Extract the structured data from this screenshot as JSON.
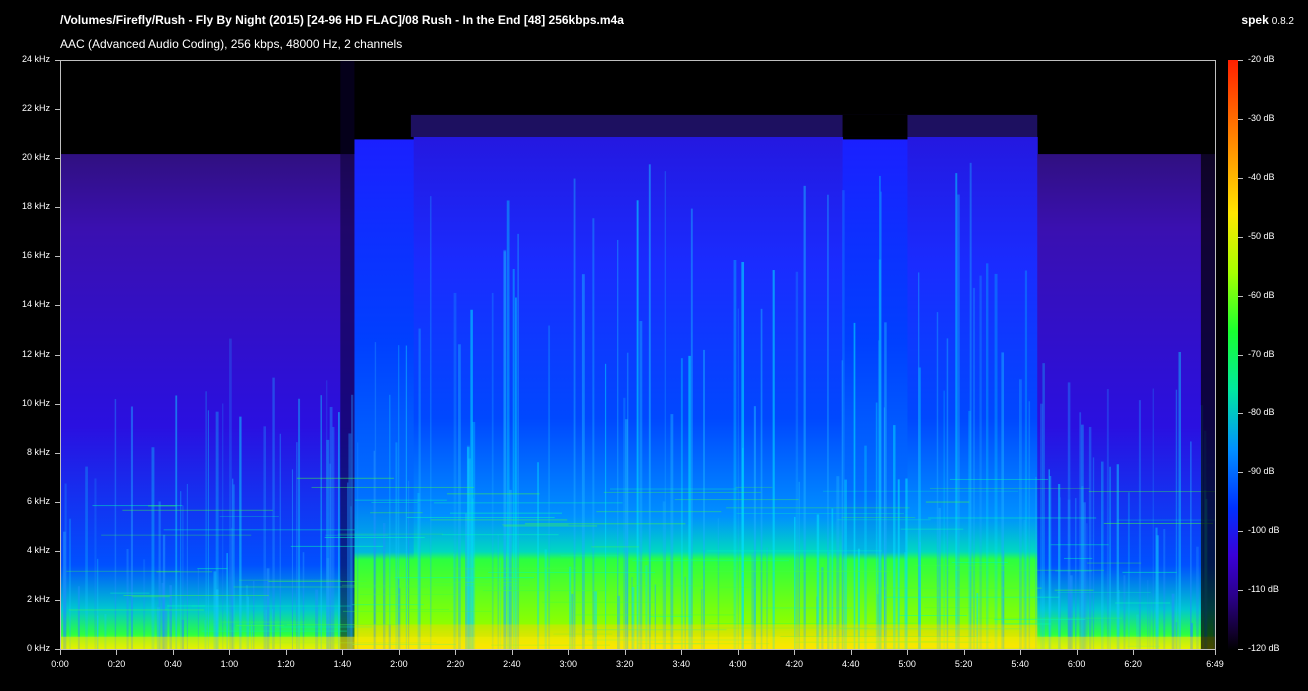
{
  "header": {
    "file_path": "/Volumes/Firefly/Rush - Fly By Night (2015) [24-96 HD FLAC]/08 Rush - In the End [48] 256kbps.m4a",
    "stream_info": "AAC (Advanced Audio Coding), 256 kbps, 48000 Hz, 2 channels",
    "app_name": "spek",
    "app_version": "0.8.2"
  },
  "chart_data": {
    "type": "heatmap",
    "title": "",
    "xlabel": "",
    "ylabel": "",
    "x_ticks": [
      "0:00",
      "0:20",
      "0:40",
      "1:00",
      "1:20",
      "1:40",
      "2:00",
      "2:20",
      "2:40",
      "3:00",
      "3:20",
      "3:40",
      "4:00",
      "4:20",
      "4:40",
      "5:00",
      "5:20",
      "5:40",
      "6:00",
      "6:20",
      "6:49"
    ],
    "y_ticks": [
      "0 kHz",
      "2 kHz",
      "4 kHz",
      "6 kHz",
      "8 kHz",
      "10 kHz",
      "12 kHz",
      "14 kHz",
      "16 kHz",
      "18 kHz",
      "20 kHz",
      "22 kHz",
      "24 kHz"
    ],
    "colorbar_ticks": [
      "-20 dB",
      "-30 dB",
      "-40 dB",
      "-50 dB",
      "-60 dB",
      "-70 dB",
      "-80 dB",
      "-90 dB",
      "-100 dB",
      "-110 dB",
      "-120 dB"
    ],
    "x_range_seconds": [
      0,
      409
    ],
    "y_range_khz": [
      0,
      24
    ],
    "db_range": [
      -120,
      -20
    ],
    "colors": {
      "background": "#000000",
      "axis": "#bfbfbf",
      "low": "#2a0088",
      "mid": "#0030ff",
      "high": "#19ff30",
      "peak": "#ffe600"
    }
  }
}
